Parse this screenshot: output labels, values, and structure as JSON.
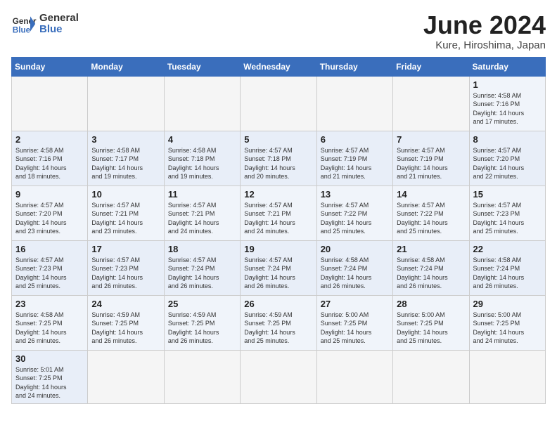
{
  "header": {
    "logo_general": "General",
    "logo_blue": "Blue",
    "title": "June 2024",
    "subtitle": "Kure, Hiroshima, Japan"
  },
  "days_of_week": [
    "Sunday",
    "Monday",
    "Tuesday",
    "Wednesday",
    "Thursday",
    "Friday",
    "Saturday"
  ],
  "weeks": [
    [
      {
        "day": "",
        "info": ""
      },
      {
        "day": "",
        "info": ""
      },
      {
        "day": "",
        "info": ""
      },
      {
        "day": "",
        "info": ""
      },
      {
        "day": "",
        "info": ""
      },
      {
        "day": "",
        "info": ""
      },
      {
        "day": "1",
        "info": "Sunrise: 4:58 AM\nSunset: 7:16 PM\nDaylight: 14 hours\nand 17 minutes."
      }
    ],
    [
      {
        "day": "2",
        "info": "Sunrise: 4:58 AM\nSunset: 7:16 PM\nDaylight: 14 hours\nand 18 minutes."
      },
      {
        "day": "3",
        "info": "Sunrise: 4:58 AM\nSunset: 7:17 PM\nDaylight: 14 hours\nand 19 minutes."
      },
      {
        "day": "4",
        "info": "Sunrise: 4:58 AM\nSunset: 7:18 PM\nDaylight: 14 hours\nand 19 minutes."
      },
      {
        "day": "5",
        "info": "Sunrise: 4:57 AM\nSunset: 7:18 PM\nDaylight: 14 hours\nand 20 minutes."
      },
      {
        "day": "6",
        "info": "Sunrise: 4:57 AM\nSunset: 7:19 PM\nDaylight: 14 hours\nand 21 minutes."
      },
      {
        "day": "7",
        "info": "Sunrise: 4:57 AM\nSunset: 7:19 PM\nDaylight: 14 hours\nand 21 minutes."
      },
      {
        "day": "8",
        "info": "Sunrise: 4:57 AM\nSunset: 7:20 PM\nDaylight: 14 hours\nand 22 minutes."
      }
    ],
    [
      {
        "day": "9",
        "info": "Sunrise: 4:57 AM\nSunset: 7:20 PM\nDaylight: 14 hours\nand 23 minutes."
      },
      {
        "day": "10",
        "info": "Sunrise: 4:57 AM\nSunset: 7:21 PM\nDaylight: 14 hours\nand 23 minutes."
      },
      {
        "day": "11",
        "info": "Sunrise: 4:57 AM\nSunset: 7:21 PM\nDaylight: 14 hours\nand 24 minutes."
      },
      {
        "day": "12",
        "info": "Sunrise: 4:57 AM\nSunset: 7:21 PM\nDaylight: 14 hours\nand 24 minutes."
      },
      {
        "day": "13",
        "info": "Sunrise: 4:57 AM\nSunset: 7:22 PM\nDaylight: 14 hours\nand 25 minutes."
      },
      {
        "day": "14",
        "info": "Sunrise: 4:57 AM\nSunset: 7:22 PM\nDaylight: 14 hours\nand 25 minutes."
      },
      {
        "day": "15",
        "info": "Sunrise: 4:57 AM\nSunset: 7:23 PM\nDaylight: 14 hours\nand 25 minutes."
      }
    ],
    [
      {
        "day": "16",
        "info": "Sunrise: 4:57 AM\nSunset: 7:23 PM\nDaylight: 14 hours\nand 25 minutes."
      },
      {
        "day": "17",
        "info": "Sunrise: 4:57 AM\nSunset: 7:23 PM\nDaylight: 14 hours\nand 26 minutes."
      },
      {
        "day": "18",
        "info": "Sunrise: 4:57 AM\nSunset: 7:24 PM\nDaylight: 14 hours\nand 26 minutes."
      },
      {
        "day": "19",
        "info": "Sunrise: 4:57 AM\nSunset: 7:24 PM\nDaylight: 14 hours\nand 26 minutes."
      },
      {
        "day": "20",
        "info": "Sunrise: 4:58 AM\nSunset: 7:24 PM\nDaylight: 14 hours\nand 26 minutes."
      },
      {
        "day": "21",
        "info": "Sunrise: 4:58 AM\nSunset: 7:24 PM\nDaylight: 14 hours\nand 26 minutes."
      },
      {
        "day": "22",
        "info": "Sunrise: 4:58 AM\nSunset: 7:24 PM\nDaylight: 14 hours\nand 26 minutes."
      }
    ],
    [
      {
        "day": "23",
        "info": "Sunrise: 4:58 AM\nSunset: 7:25 PM\nDaylight: 14 hours\nand 26 minutes."
      },
      {
        "day": "24",
        "info": "Sunrise: 4:59 AM\nSunset: 7:25 PM\nDaylight: 14 hours\nand 26 minutes."
      },
      {
        "day": "25",
        "info": "Sunrise: 4:59 AM\nSunset: 7:25 PM\nDaylight: 14 hours\nand 26 minutes."
      },
      {
        "day": "26",
        "info": "Sunrise: 4:59 AM\nSunset: 7:25 PM\nDaylight: 14 hours\nand 25 minutes."
      },
      {
        "day": "27",
        "info": "Sunrise: 5:00 AM\nSunset: 7:25 PM\nDaylight: 14 hours\nand 25 minutes."
      },
      {
        "day": "28",
        "info": "Sunrise: 5:00 AM\nSunset: 7:25 PM\nDaylight: 14 hours\nand 25 minutes."
      },
      {
        "day": "29",
        "info": "Sunrise: 5:00 AM\nSunset: 7:25 PM\nDaylight: 14 hours\nand 24 minutes."
      }
    ],
    [
      {
        "day": "30",
        "info": "Sunrise: 5:01 AM\nSunset: 7:25 PM\nDaylight: 14 hours\nand 24 minutes."
      },
      {
        "day": "",
        "info": ""
      },
      {
        "day": "",
        "info": ""
      },
      {
        "day": "",
        "info": ""
      },
      {
        "day": "",
        "info": ""
      },
      {
        "day": "",
        "info": ""
      },
      {
        "day": "",
        "info": ""
      }
    ]
  ]
}
